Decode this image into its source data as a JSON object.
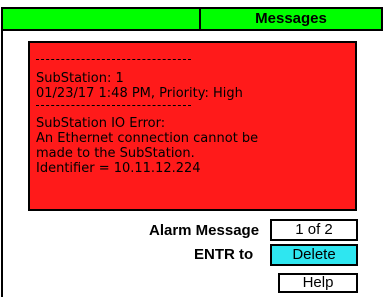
{
  "header": {
    "title": "Messages"
  },
  "message": {
    "substation_line": "SubStation: 1",
    "datetime_priority_line": "01/23/17 1:48 PM, Priority: High",
    "error_title": "SubStation IO Error:",
    "body_lines": [
      "An Ethernet connection cannot be",
      "made to the SubStation.",
      "Identifier = 10.11.12.224"
    ]
  },
  "alarm": {
    "label": "Alarm Message",
    "value": "1 of 2"
  },
  "entr": {
    "label": "ENTR to",
    "delete_label": "Delete"
  },
  "help": {
    "label": "Help"
  },
  "colors": {
    "header_bg": "#00ff00",
    "message_bg": "#ff1a1a",
    "delete_bg": "#2ee6f0"
  }
}
